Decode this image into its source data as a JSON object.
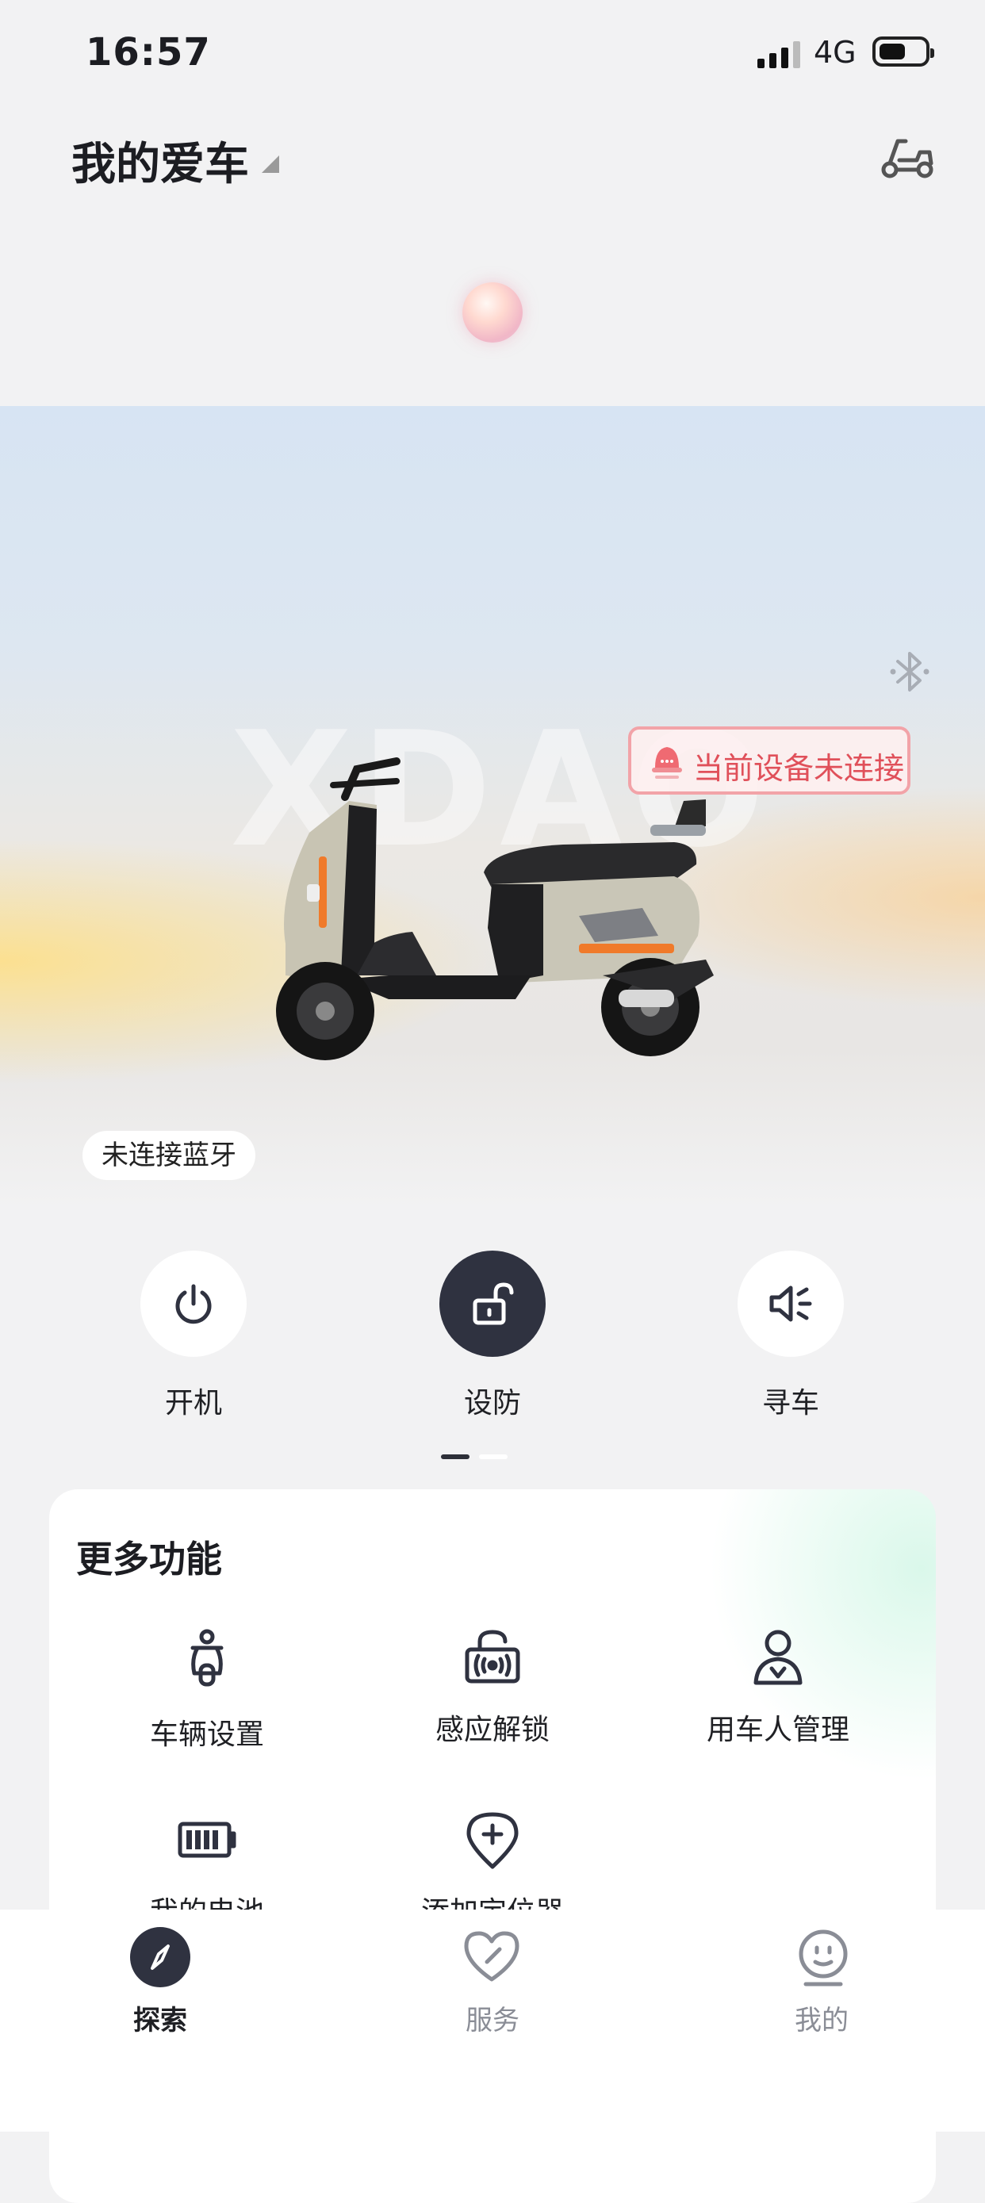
{
  "status_bar": {
    "time": "16:57",
    "network": "4G"
  },
  "header": {
    "title": "我的爱车"
  },
  "hero": {
    "watermark": "XDAO",
    "alert": "当前设备未连接",
    "bluetooth_status": "未连接蓝牙"
  },
  "controls": [
    {
      "label": "开机",
      "icon": "power-icon"
    },
    {
      "label": "设防",
      "icon": "unlock-icon"
    },
    {
      "label": "寻车",
      "icon": "speaker-icon"
    }
  ],
  "more": {
    "title": "更多功能",
    "items": [
      {
        "label": "车辆设置",
        "icon": "scooter-settings-icon"
      },
      {
        "label": "感应解锁",
        "icon": "nfc-unlock-icon"
      },
      {
        "label": "用车人管理",
        "icon": "user-icon"
      },
      {
        "label": "我的电池",
        "icon": "battery-icon"
      },
      {
        "label": "添加定位器",
        "icon": "add-locator-icon"
      }
    ]
  },
  "tabbar": {
    "tabs": [
      {
        "label": "探索",
        "icon": "compass-icon",
        "active": true
      },
      {
        "label": "服务",
        "icon": "heart-icon",
        "active": false
      },
      {
        "label": "我的",
        "icon": "smile-icon",
        "active": false
      }
    ]
  },
  "colors": {
    "accent_dark": "#2f3240",
    "alert_red": "#e0505a",
    "alert_border": "#f2a3a8"
  }
}
